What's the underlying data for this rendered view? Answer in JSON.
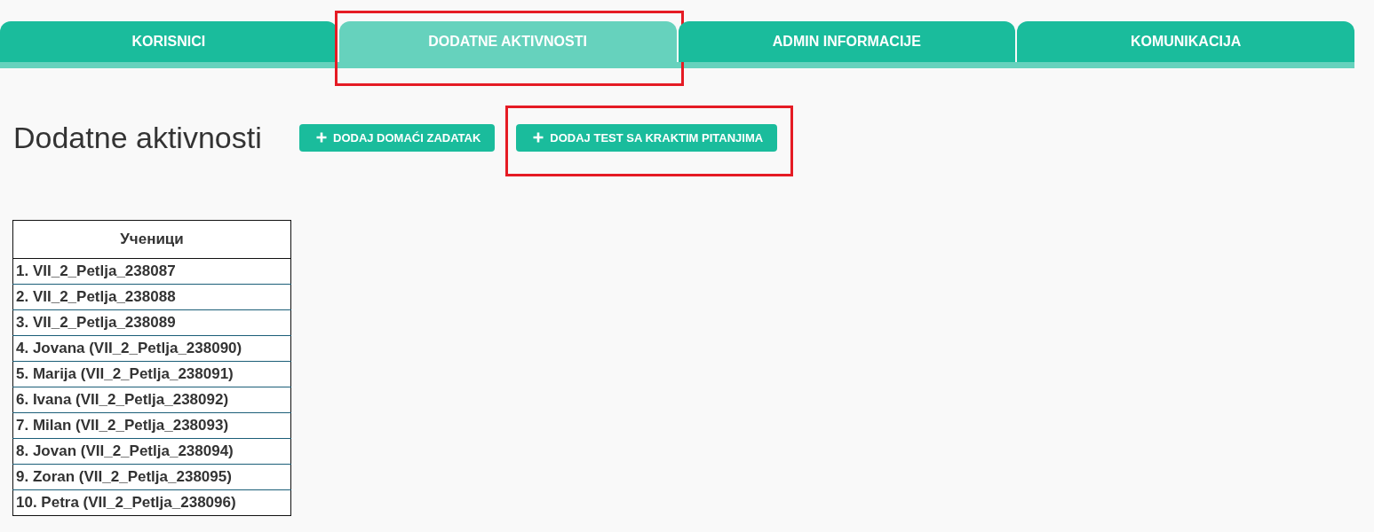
{
  "tabs": [
    {
      "label": "KORISNICI",
      "selected": false,
      "highlighted": false
    },
    {
      "label": "DODATNE AKTIVNOSTI",
      "selected": true,
      "highlighted": true
    },
    {
      "label": "ADMIN INFORMACIJE",
      "selected": false,
      "highlighted": false
    },
    {
      "label": "KOMUNIKACIJA",
      "selected": false,
      "highlighted": false
    }
  ],
  "page": {
    "title": "Dodatne aktivnosti"
  },
  "buttons": [
    {
      "label": "DODAJ DOMAĆI ZADATAK",
      "highlighted": false
    },
    {
      "label": "DODAJ TEST SA KRAKTIM PITANJIMA",
      "highlighted": true
    }
  ],
  "table": {
    "columns": [
      "Ученици"
    ],
    "rows": [
      [
        "1. VII_2_Petlja_238087"
      ],
      [
        "2. VII_2_Petlja_238088"
      ],
      [
        "3. VII_2_Petlja_238089"
      ],
      [
        "4. Jovana (VII_2_Petlja_238090)"
      ],
      [
        "5. Marija (VII_2_Petlja_238091)"
      ],
      [
        "6. Ivana (VII_2_Petlja_238092)"
      ],
      [
        "7. Milan (VII_2_Petlja_238093)"
      ],
      [
        "8. Jovan (VII_2_Petlja_238094)"
      ],
      [
        "9. Zoran (VII_2_Petlja_238095)"
      ],
      [
        "10. Petra (VII_2_Petlja_238096)"
      ]
    ]
  }
}
